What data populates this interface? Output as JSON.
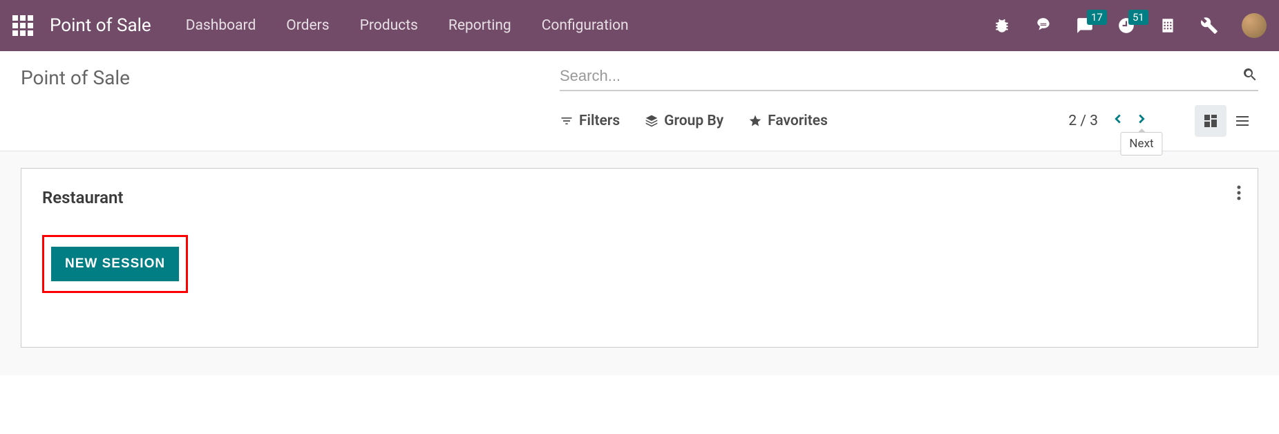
{
  "header": {
    "brand": "Point of Sale",
    "nav": [
      "Dashboard",
      "Orders",
      "Products",
      "Reporting",
      "Configuration"
    ],
    "badges": {
      "messages": "17",
      "activities": "51"
    }
  },
  "page": {
    "title": "Point of Sale",
    "search_placeholder": "Search..."
  },
  "toolbar": {
    "filters": "Filters",
    "group_by": "Group By",
    "favorites": "Favorites",
    "pager": "2 / 3",
    "next_tooltip": "Next"
  },
  "card": {
    "title": "Restaurant",
    "new_session": "NEW SESSION"
  }
}
